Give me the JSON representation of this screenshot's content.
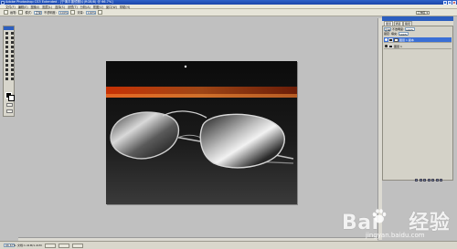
{
  "window": {
    "title": "Adobe Photoshop CS3 Extended - [宁清平墨镜照片(RGB/8) @ 66.7%]"
  },
  "menubar": {
    "items": [
      "文件(F)",
      "编辑(E)",
      "图像(I)",
      "图层(L)",
      "选择(S)",
      "滤镜(T)",
      "分析(A)",
      "视图(V)",
      "窗口(W)",
      "帮助(H)"
    ]
  },
  "options": {
    "size_label": "画笔:",
    "mode_label": "模式:",
    "mode_value": "正常",
    "opacity_label": "不透明度:",
    "opacity_value": "100%",
    "flow_label": "流量:",
    "flow_value": "100%",
    "workspace_label": "工作区 ▾"
  },
  "layers_panel": {
    "tabs": [
      "图层",
      "通道",
      "路径"
    ],
    "blend_mode": "正常",
    "opacity_label": "不透明度:",
    "opacity_value": "100%",
    "lock_label": "锁定:",
    "fill_label": "填充:",
    "fill_value": "100%",
    "layers": [
      {
        "name": "图层 1 副本",
        "selected": true
      },
      {
        "name": "图层 1",
        "selected": false
      }
    ]
  },
  "status": {
    "zoom": "66.67%",
    "doc_info": "文档:1.41M/1.41M"
  },
  "watermark": {
    "text_left": "Bai",
    "text_right": "经验",
    "url": "jingyan.baidu.com"
  },
  "colors": {
    "title_blue": "#1b44a8",
    "accent_orange": "#ff5a10"
  },
  "icons": [
    "photoshop-icon",
    "minimize-icon",
    "maximize-icon",
    "close-icon",
    "eye-icon",
    "baidu-paw-icon"
  ]
}
